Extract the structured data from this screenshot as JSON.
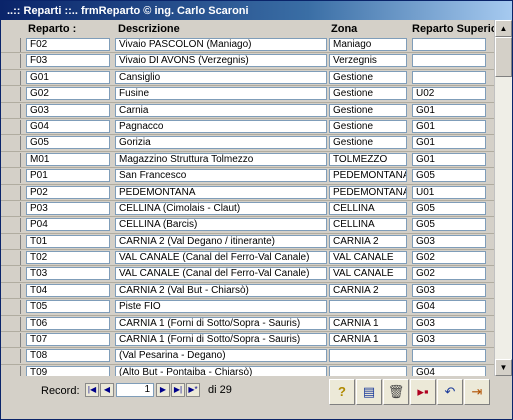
{
  "window": {
    "title": "..:: Reparti ::..   frmReparto © ing. Carlo Scaroni"
  },
  "headers": {
    "reparto": "Reparto :",
    "descrizione": "Descrizione",
    "zona": "Zona",
    "superiore": "Reparto Superiore"
  },
  "rows": [
    {
      "reparto": "F02",
      "descrizione": "Vivaio PASCOLON (Maniago)",
      "zona": "Maniago",
      "superiore": ""
    },
    {
      "reparto": "F03",
      "descrizione": "Vivaio DI AVONS (Verzegnis)",
      "zona": "Verzegnis",
      "superiore": ""
    },
    {
      "reparto": "G01",
      "descrizione": "Cansiglio",
      "zona": "Gestione",
      "superiore": ""
    },
    {
      "reparto": "G02",
      "descrizione": "Fusine",
      "zona": "Gestione",
      "superiore": "U02"
    },
    {
      "reparto": "G03",
      "descrizione": "Carnia",
      "zona": "Gestione",
      "superiore": "G01"
    },
    {
      "reparto": "G04",
      "descrizione": "Pagnacco",
      "zona": "Gestione",
      "superiore": "G01"
    },
    {
      "reparto": "G05",
      "descrizione": "Gorizia",
      "zona": "Gestione",
      "superiore": "G01"
    },
    {
      "reparto": "M01",
      "descrizione": "Magazzino Struttura Tolmezzo",
      "zona": "TOLMEZZO",
      "superiore": "G01"
    },
    {
      "reparto": "P01",
      "descrizione": "San Francesco",
      "zona": "PEDEMONTANA",
      "superiore": "G05"
    },
    {
      "reparto": "P02",
      "descrizione": "PEDEMONTANA",
      "zona": "PEDEMONTANA",
      "superiore": "U01"
    },
    {
      "reparto": "P03",
      "descrizione": "CELLINA (Cimolais - Claut)",
      "zona": "CELLINA",
      "superiore": "G05"
    },
    {
      "reparto": "P04",
      "descrizione": "CELLINA (Barcis)",
      "zona": "CELLINA",
      "superiore": "G05"
    },
    {
      "reparto": "T01",
      "descrizione": "CARNIA 2 (Val Degano / itinerante)",
      "zona": "CARNIA 2",
      "superiore": "G03"
    },
    {
      "reparto": "T02",
      "descrizione": "VAL CANALE (Canal del Ferro-Val Canale)",
      "zona": "VAL CANALE",
      "superiore": "G02"
    },
    {
      "reparto": "T03",
      "descrizione": "VAL CANALE (Canal del Ferro-Val Canale)",
      "zona": "VAL CANALE",
      "superiore": "G02"
    },
    {
      "reparto": "T04",
      "descrizione": "CARNIA 2 (Val But - Chiarsò)",
      "zona": "CARNIA 2",
      "superiore": "G03"
    },
    {
      "reparto": "T05",
      "descrizione": "Piste FIO",
      "zona": "",
      "superiore": "G04"
    },
    {
      "reparto": "T06",
      "descrizione": "CARNIA 1 (Forni di Sotto/Sopra - Sauris)",
      "zona": "CARNIA 1",
      "superiore": "G03"
    },
    {
      "reparto": "T07",
      "descrizione": "CARNIA 1 (Forni di Sotto/Sopra - Sauris)",
      "zona": "CARNIA 1",
      "superiore": "G03"
    },
    {
      "reparto": "T08",
      "descrizione": "(Val Pesarina - Degano)",
      "zona": "",
      "superiore": ""
    },
    {
      "reparto": "T09",
      "descrizione": "(Alto But - Pontaiba - Chiarsò)",
      "zona": "",
      "superiore": "G04"
    }
  ],
  "navigation": {
    "label": "Record:",
    "current": "1",
    "of_label": "di",
    "total": "29"
  },
  "toolbar": {
    "icons": [
      "help-icon",
      "new-record-icon",
      "delete-icon",
      "navigate-icon",
      "undo-icon",
      "exit-icon"
    ]
  }
}
